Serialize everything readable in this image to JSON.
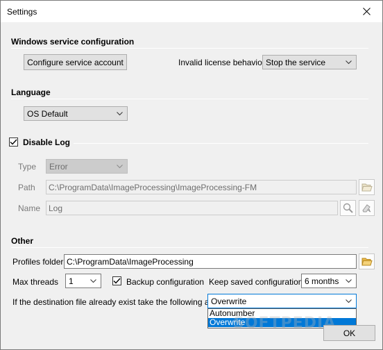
{
  "window": {
    "title": "Settings"
  },
  "service": {
    "section_title": "Windows service configuration",
    "configure_button": "Configure service account",
    "license_label": "Invalid license behavior",
    "license_value": "Stop the service"
  },
  "language": {
    "section_title": "Language",
    "value": "OS Default"
  },
  "log": {
    "checkbox_label": "Disable Log",
    "checked": true,
    "type_label": "Type",
    "type_value": "Error",
    "path_label": "Path",
    "path_value": "C:\\ProgramData\\ImageProcessing\\ImageProcessing-FM",
    "name_label": "Name",
    "name_value": "Log"
  },
  "other": {
    "section_title": "Other",
    "profiles_label": "Profiles folder:",
    "profiles_value": "C:\\ProgramData\\ImageProcessing",
    "threads_label": "Max threads",
    "threads_value": "1",
    "backup_label": "Backup configuration",
    "backup_checked": true,
    "keep_label": "Keep saved configurations",
    "keep_value": "6 months",
    "action_label": "If the destination file already exist take the following action:",
    "action_value": "Overwrite",
    "action_options": [
      "Autonumber",
      "Overwrite"
    ],
    "action_selected": "Overwrite"
  },
  "footer": {
    "ok_button": "OK"
  },
  "watermark": "SOFTPEDIA",
  "colors": {
    "accent": "#0078d7",
    "folder": "#e8b84a"
  }
}
